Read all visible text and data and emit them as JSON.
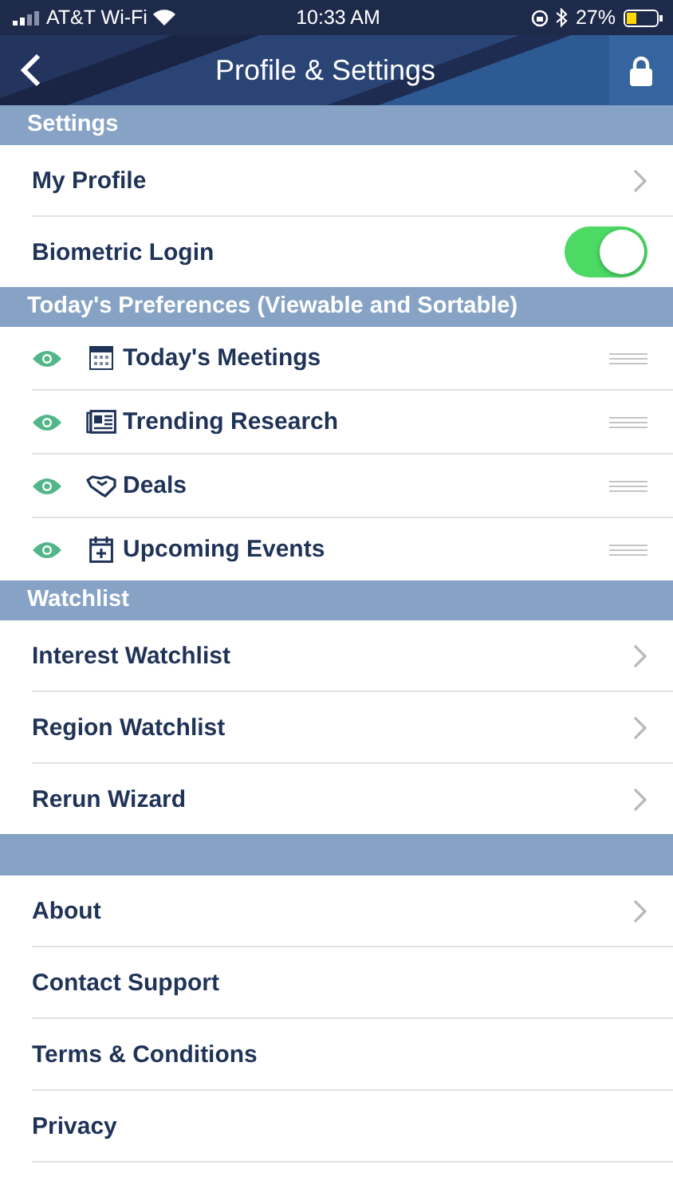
{
  "status_bar": {
    "carrier": "AT&T Wi-Fi",
    "time": "10:33 AM",
    "battery": "27%"
  },
  "nav": {
    "title": "Profile & Settings"
  },
  "sections": [
    {
      "title": "Settings",
      "rows": [
        {
          "kind": "link",
          "label": "My Profile"
        },
        {
          "kind": "toggle",
          "label": "Biometric Login",
          "on": true
        }
      ]
    },
    {
      "title": "Today's Preferences (Viewable and Sortable)",
      "rows": [
        {
          "kind": "preference",
          "label": "Today's Meetings",
          "visible": true
        },
        {
          "kind": "preference",
          "label": "Trending Research",
          "visible": true
        },
        {
          "kind": "preference",
          "label": "Deals",
          "visible": true
        },
        {
          "kind": "preference",
          "label": "Upcoming Events",
          "visible": true
        }
      ]
    },
    {
      "title": "Watchlist",
      "rows": [
        {
          "kind": "link",
          "label": "Interest Watchlist"
        },
        {
          "kind": "link",
          "label": "Region Watchlist"
        },
        {
          "kind": "link",
          "label": "Rerun Wizard"
        }
      ]
    },
    {
      "rows": [
        {
          "kind": "link",
          "label": "About"
        },
        {
          "kind": "plain",
          "label": "Contact Support"
        },
        {
          "kind": "plain",
          "label": "Terms & Conditions"
        },
        {
          "kind": "plain",
          "label": "Privacy"
        }
      ]
    }
  ]
}
